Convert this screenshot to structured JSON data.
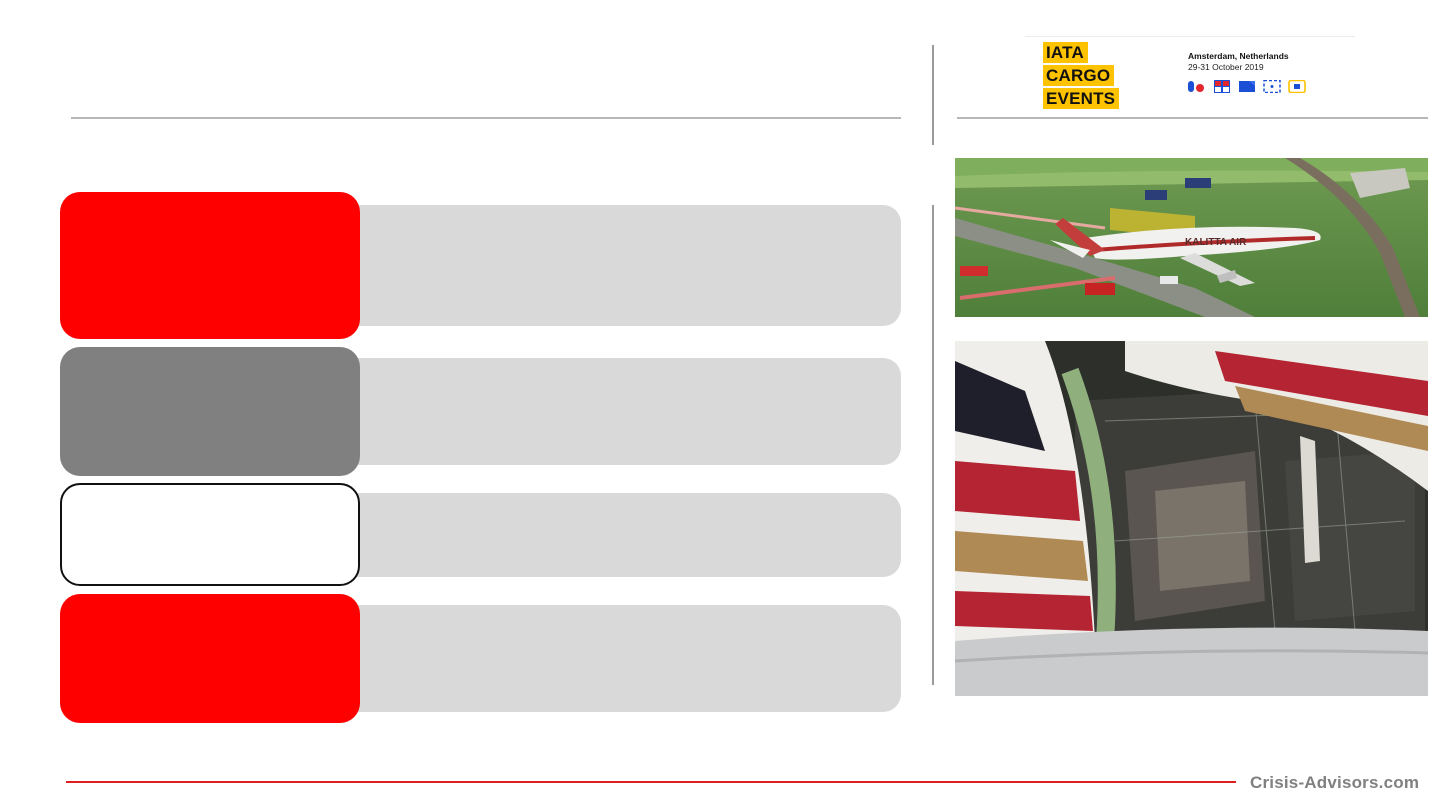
{
  "logo": {
    "words": [
      "IATA",
      "CARGO",
      "EVENTS"
    ],
    "brand_color": "#fdc300"
  },
  "event": {
    "place": "Amsterdam, Netherlands",
    "dates": "29-31 October 2019"
  },
  "event_badges": [
    "cargo-badge-icon",
    "dangerous-goods-badge-icon",
    "pharma-badge-icon",
    "eu-badge-icon",
    "digital-badge-icon"
  ],
  "rows": [
    {
      "tile_color": "#ff0000"
    },
    {
      "tile_color": "#808080"
    },
    {
      "tile_color": "#ffffff"
    },
    {
      "tile_color": "#ff0000"
    }
  ],
  "photos": [
    {
      "name": "crashed-cargo-aircraft-aerial-photo",
      "fuselage_text": "KALITTA AIR"
    },
    {
      "name": "damaged-fuselage-cargo-hold-photo"
    }
  ],
  "footer": {
    "site": "Crisis-Advisors.com"
  },
  "colors": {
    "accent_red": "#ff0000",
    "bar_gray": "#d9d9d9",
    "footer_line": "#e02020"
  }
}
